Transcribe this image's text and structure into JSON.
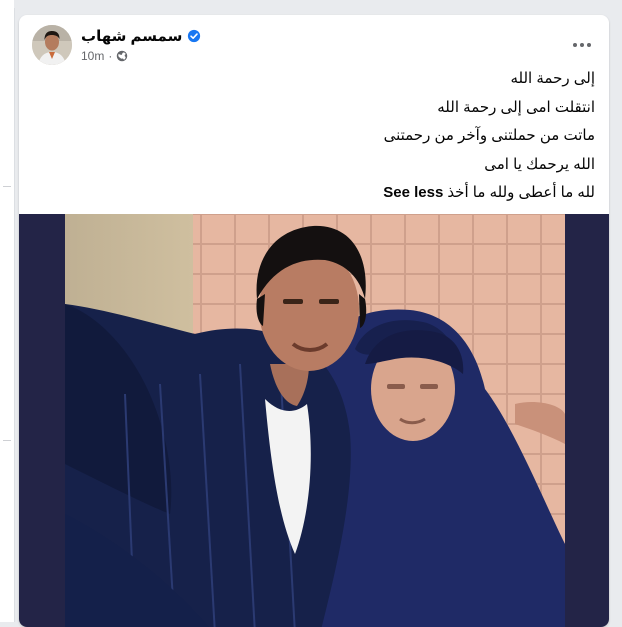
{
  "post": {
    "author": "سمسم شهاب",
    "timestamp": "10m",
    "lines": [
      "إلى رحمة الله",
      "انتقلت امى إلى رحمة الله",
      "ماتت من حملتنى وآخر من رحمتنى",
      "الله يرحمك يا امى",
      "لله ما أعطى ولله ما أخذ"
    ],
    "see_less": "See less"
  },
  "icons": {
    "verified": "verified-badge-icon",
    "audience": "globe-icon",
    "more": "more-options-icon"
  },
  "colors": {
    "verified": "#1877f2",
    "text": "#050505",
    "meta": "#65676b",
    "photo_frame": "#232447"
  }
}
